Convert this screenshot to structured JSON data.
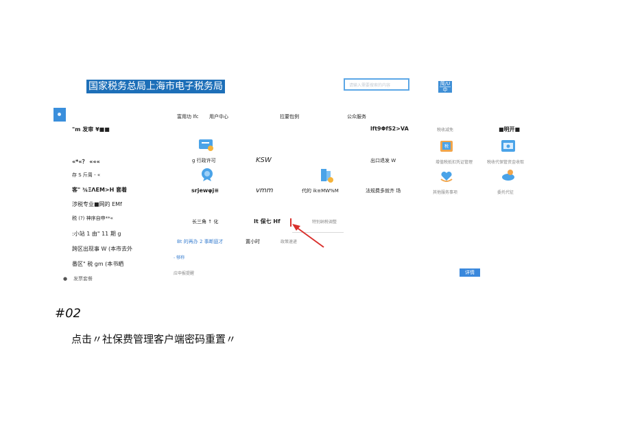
{
  "header": {
    "title": "国家税务总局上海市电子税务局",
    "search_placeholder": "请输入需要搜索的内容",
    "lang_lines": [
      "简/U",
      "中"
    ]
  },
  "sidebar": {
    "items": [
      "\"m 发审 ¥■■",
      "«*«？ «««",
      "存 S 斤周 - «",
      "客\" ¾ΞΛΕΜ>Η 套着",
      "涉税专业■网的 EMf",
      "税 (?) 神序自申**«",
      ":小站 1 由\" 11 期 g",
      "跨区出现事 W (本市去外",
      "番区\" 税 gm (本书晒",
      "发票套餐"
    ]
  },
  "nav": {
    "tabs": [
      "富用功 lfc",
      "用户中心",
      "拉要包例",
      "公众服务"
    ]
  },
  "grid": {
    "row0": [
      "lft9ΦfS2>VA",
      "税收减免",
      "■明开■"
    ],
    "row1": [
      "g 行政许可",
      "KSW",
      "出口退发 W",
      "增值税抵扣凭证管理",
      "税收代保管资金收取"
    ],
    "row2": [
      "srjewφj≡",
      "vmm",
      "代的 ik≡MW%M",
      "法规费多就齐 场",
      "其他服务事项",
      "委托代征"
    ],
    "row3": [
      "长三角 ↑ 化",
      "It 保七 Hf",
      "特别纳税调整"
    ],
    "row4": [
      "Bt 的再办 2 事断庭才",
      "置小时",
      "政策速递"
    ],
    "row5": "- 够称",
    "row6": "应申报提醒",
    "detail_button": "详情"
  },
  "step": {
    "number": "#02",
    "instruction": "点击〃社保费管理客户端密码重置〃"
  },
  "colors": {
    "brand_blue": "#1d6fb8",
    "button_blue": "#3a88dc",
    "arrow_red": "#d9302c"
  }
}
